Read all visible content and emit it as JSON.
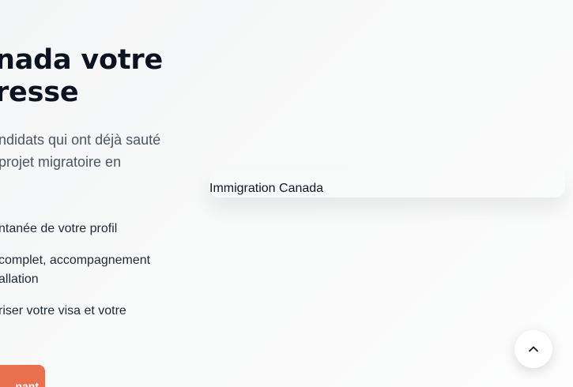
{
  "hero": {
    "title_lines": [
      "nada votre",
      "resse"
    ],
    "subtitle_lines": [
      "ndidats qui ont déjà sauté",
      " projet migratoire en"
    ],
    "features": [
      {
        "lines": [
          "ntanée de votre profil"
        ]
      },
      {
        "lines": [
          " complet, accompagnement",
          "allation"
        ]
      },
      {
        "lines": [
          "riser votre visa et votre"
        ]
      }
    ],
    "cta_label": "nant"
  },
  "image": {
    "alt_text": "Immigration Canada"
  },
  "scroll_top": {
    "icon": "chevron-up-icon"
  }
}
